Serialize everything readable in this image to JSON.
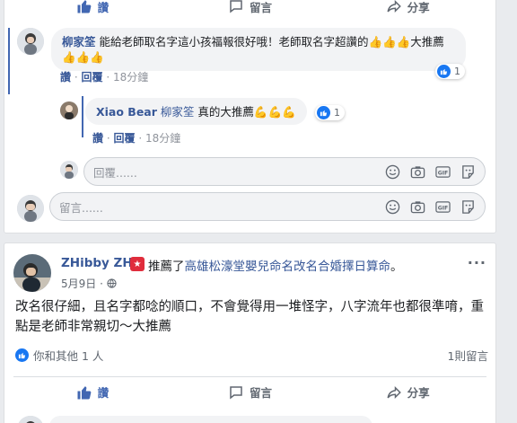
{
  "colors": {
    "accent": "#4267b2",
    "link": "#385898",
    "like_blue": "#1877f2",
    "muted": "#90949c"
  },
  "top_actions": {
    "like": "讚",
    "comment": "留言",
    "share": "分享"
  },
  "comment1": {
    "author": "柳家筌",
    "text": "能給老師取名字這小孩福報很好哦！老師取名字超讚的👍👍👍大推薦👍👍👍",
    "reply_action": "回覆",
    "like_action": "讚",
    "time": "18分鐘",
    "like_count": "1"
  },
  "reply1": {
    "author": "Xiao Bear",
    "mention": "柳家筌",
    "text": " 真的大推薦💪💪💪",
    "like_action": "讚",
    "reply_action": "回覆",
    "time": "18分鐘",
    "like_count": "1"
  },
  "reply_input": {
    "placeholder": "回覆......"
  },
  "comment_input": {
    "placeholder": "留言......"
  },
  "separator": "·",
  "post": {
    "author": "ZHibby ZHi",
    "verb": "推薦了",
    "page": "高雄松濠堂嬰兒命名改名合婚擇日算命",
    "period": "。",
    "date": "5月9日",
    "privacy_sep": "·",
    "body": "改名很仔細，且名字都唸的順口，不會覺得用一堆怪字，八字流年也都很準唷，重點是老師非常親切～大推薦",
    "likes_text": "你和其他 1 人",
    "comments_text": "1則留言",
    "more": "···",
    "actions": {
      "like": "讚",
      "comment": "留言",
      "share": "分享"
    }
  }
}
